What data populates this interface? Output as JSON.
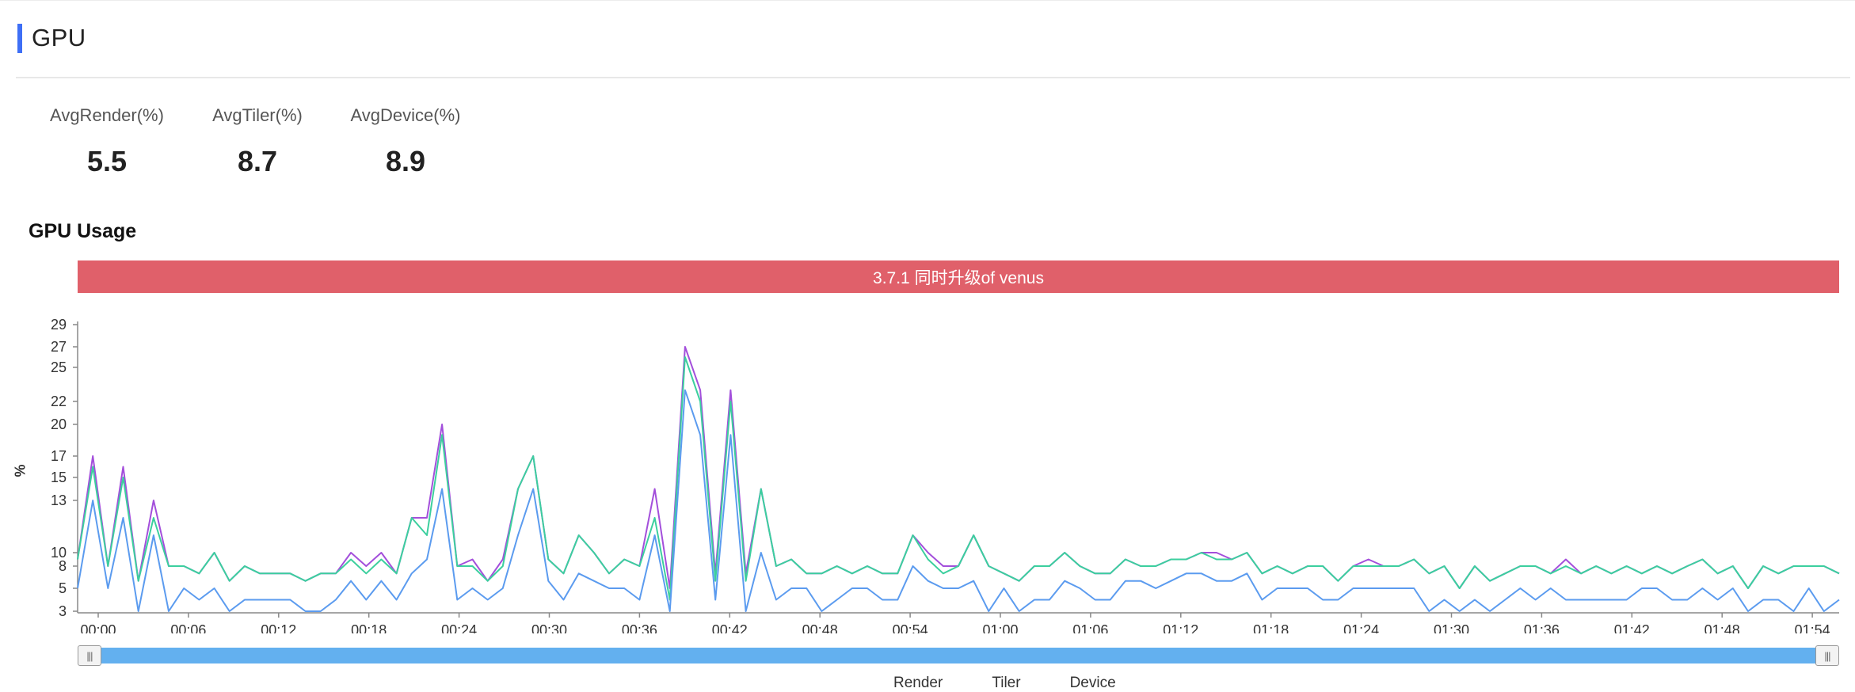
{
  "section": {
    "title": "GPU",
    "accent_color": "#3e6ff6"
  },
  "stats": [
    {
      "label": "AvgRender(%)",
      "value": "5.5"
    },
    {
      "label": "AvgTiler(%)",
      "value": "8.7"
    },
    {
      "label": "AvgDevice(%)",
      "value": "8.9"
    }
  ],
  "chart_title": "GPU Usage",
  "banner": {
    "text": "3.7.1 同时升级of venus",
    "color": "#e0606a"
  },
  "slider": {
    "start_icon": "grip-icon",
    "end_icon": "grip-icon",
    "range": [
      0,
      1
    ]
  },
  "chart_data": {
    "type": "line",
    "title": "GPU Usage",
    "xlabel": "",
    "ylabel": "%",
    "x_tick_labels": [
      "00:00",
      "00:06",
      "00:12",
      "00:18",
      "00:24",
      "00:30",
      "00:36",
      "00:42",
      "00:48",
      "00:54",
      "01:00",
      "01:06",
      "01:12",
      "01:18",
      "01:24",
      "01:30",
      "01:36",
      "01:42",
      "01:48",
      "01:54"
    ],
    "y_tick_labels": [
      "3",
      "5",
      "8",
      "10",
      "13",
      "15",
      "17",
      "20",
      "22",
      "25",
      "27",
      "29"
    ],
    "ylim": [
      3,
      29
    ],
    "y_scale": "nonlinear (printed tick labels unevenly spaced)",
    "grid": false,
    "legend_position": "bottom",
    "series": [
      {
        "name": "Render",
        "color": "#5b9bef",
        "values": [
          5,
          13,
          5,
          12,
          3,
          11,
          3,
          5,
          4,
          5,
          3,
          4,
          4,
          4,
          4,
          3,
          3,
          4,
          6,
          4,
          6,
          4,
          7,
          9,
          14,
          4,
          5,
          4,
          5,
          11,
          14,
          6,
          4,
          7,
          6,
          5,
          5,
          4,
          11,
          3,
          23,
          19,
          4,
          19,
          3,
          10,
          4,
          5,
          5,
          3,
          4,
          5,
          5,
          4,
          4,
          8,
          6,
          5,
          5,
          6,
          3,
          5,
          3,
          4,
          4,
          6,
          5,
          4,
          4,
          6,
          6,
          5,
          6,
          7,
          7,
          6,
          6,
          7,
          4,
          5,
          5,
          5,
          4,
          4,
          5,
          5,
          5,
          5,
          5,
          3,
          4,
          3,
          4,
          3,
          4,
          5,
          4,
          5,
          4,
          4,
          4,
          4,
          4,
          5,
          5,
          4,
          4,
          5,
          4,
          5,
          3,
          4,
          4,
          3,
          5,
          3,
          4
        ]
      },
      {
        "name": "Tiler",
        "color": "#3ccf9e",
        "values": [
          9,
          16,
          8,
          15,
          6,
          12,
          8,
          8,
          7,
          10,
          6,
          8,
          7,
          7,
          7,
          6,
          7,
          7,
          9,
          7,
          9,
          7,
          12,
          11,
          19,
          8,
          8,
          6,
          8,
          14,
          17,
          9,
          7,
          11,
          10,
          7,
          9,
          8,
          12,
          4,
          26,
          22,
          6,
          22,
          6,
          14,
          8,
          9,
          7,
          7,
          8,
          7,
          8,
          7,
          7,
          11,
          9,
          7,
          8,
          11,
          8,
          7,
          6,
          8,
          8,
          10,
          8,
          7,
          7,
          9,
          8,
          8,
          9,
          9,
          10,
          9,
          9,
          10,
          7,
          8,
          7,
          8,
          8,
          6,
          8,
          8,
          8,
          8,
          9,
          7,
          8,
          5,
          8,
          6,
          7,
          8,
          8,
          7,
          8,
          7,
          8,
          7,
          8,
          7,
          8,
          7,
          8,
          9,
          7,
          8,
          5,
          8,
          7,
          8,
          8,
          8,
          7
        ]
      },
      {
        "name": "Device",
        "color": "#a34fdb",
        "values": [
          9,
          17,
          8,
          16,
          6,
          13,
          8,
          8,
          7,
          10,
          6,
          8,
          7,
          7,
          7,
          6,
          7,
          7,
          10,
          8,
          10,
          7,
          12,
          12,
          20,
          8,
          9,
          6,
          9,
          14,
          17,
          9,
          7,
          11,
          10,
          7,
          9,
          8,
          14,
          5,
          27,
          23,
          7,
          23,
          7,
          14,
          8,
          9,
          7,
          7,
          8,
          7,
          8,
          7,
          7,
          11,
          10,
          8,
          8,
          11,
          8,
          7,
          6,
          8,
          8,
          10,
          8,
          7,
          7,
          9,
          8,
          8,
          9,
          9,
          10,
          10,
          9,
          10,
          7,
          8,
          7,
          8,
          8,
          6,
          8,
          9,
          8,
          8,
          9,
          7,
          8,
          5,
          8,
          6,
          7,
          8,
          8,
          7,
          9,
          7,
          8,
          7,
          8,
          7,
          8,
          7,
          8,
          9,
          7,
          8,
          5,
          8,
          7,
          8,
          8,
          8,
          7
        ]
      }
    ]
  }
}
